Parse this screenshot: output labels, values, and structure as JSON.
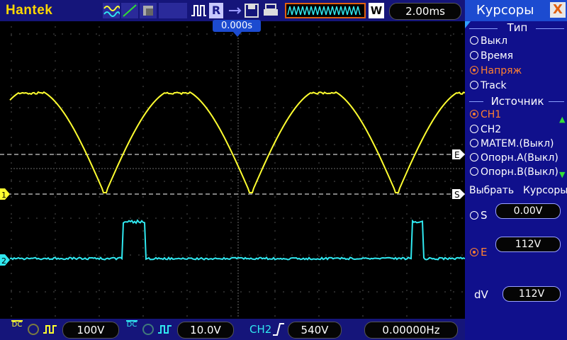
{
  "brand": "Hantek",
  "timebase": "2.00ms",
  "trigger_time": "0.000s",
  "toolbar": {
    "run_label": "R",
    "mode_label": "W"
  },
  "channel_markers": {
    "ch1": "1",
    "ch2": "2"
  },
  "cursor_markers": {
    "e": "E",
    "s": "S"
  },
  "bottom": {
    "ch1_volts": "100V",
    "ch2_volts": "10.0V",
    "trigger_source": "CH2",
    "trigger_level": "540V",
    "frequency": "0.00000Hz",
    "coupling_label": "DC"
  },
  "panel": {
    "title": "Курсоры",
    "close": "X",
    "type_title": "Тип",
    "type_options": [
      "Выкл",
      "Время",
      "Напряж",
      "Track"
    ],
    "type_selected": "Напряж",
    "source_title": "Источник",
    "source_options": [
      "CH1",
      "CH2",
      "MATEM.(Выкл)",
      "Опорн.A(Выкл)",
      "Опорн.B(Выкл)"
    ],
    "source_selected": "CH1",
    "select_label": "Выбрать",
    "cursor_label": "Курсоры",
    "s_label": "S",
    "s_value": "0.00V",
    "e_label": "E",
    "e_value": "112V",
    "dv_label": "dV",
    "dv_value": "112V"
  },
  "colors": {
    "ch1": "#ffff30",
    "ch2": "#30e8f0",
    "accent": "#ff8030",
    "bar": "#15157a",
    "panel": "#10108c"
  }
}
